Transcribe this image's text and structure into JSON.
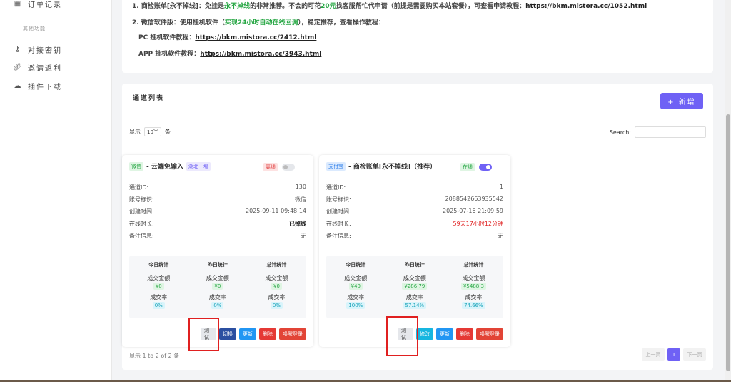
{
  "sidebar": {
    "order_record": "订单记录",
    "section_other": "其他功能",
    "items": [
      {
        "label": "对接密钥",
        "icon": "key-icon"
      },
      {
        "label": "邀请返利",
        "icon": "link-icon"
      },
      {
        "label": "插件下载",
        "icon": "cloud-download-icon"
      }
    ]
  },
  "notice": {
    "line1_prefix": "1. 商检账单[永不掉线]：免挂是",
    "line1_green": "永不掉线",
    "line1_mid": "的非常推荐。不会的可花",
    "line1_green2": "20元",
    "line1_suffix": "找客服帮忙代申请（前提是需要购买本站套餐），可查看申请教程：",
    "line1_link": "https://bkm.mistora.cc/1052.html",
    "line2_prefix": "2. 微信软件版：使用挂机软件（",
    "line2_green": "实现24小时自动在线回调",
    "line2_suffix": "），稳定推荐，查看操作教程：",
    "pc_label": "PC 挂机软件教程：",
    "pc_link": "https://bkm.mistora.cc/2412.html",
    "app_label": "APP 挂机软件教程：",
    "app_link": "https://bkm.mistora.cc/3943.html"
  },
  "list": {
    "title": "通道列表",
    "add_label": "+ 新增",
    "show_label": "显示",
    "page_size": "10",
    "items_label": "条",
    "search_label": "Search:",
    "footer": "显示 1 to 2 of 2 条",
    "prev": "上一页",
    "current_page": "1",
    "next": "下一页"
  },
  "labels": {
    "channel_id": "通道ID:",
    "account": "账号标识:",
    "created": "创建时间:",
    "online": "在线时长:",
    "remark": "备注信息:",
    "today": "今日统计",
    "yesterday": "昨日统计",
    "total": "总计统计",
    "amount": "成交金额",
    "rate": "成交率"
  },
  "channels": [
    {
      "tag": "微信",
      "name": "- 云端免输入",
      "region": "湖北十堰",
      "status": "离线",
      "id": "130",
      "account": "微信",
      "created": "2025-09-11 09:48:14",
      "online": "已掉线",
      "remark": "无",
      "today_amount": "¥0",
      "yesterday_amount": "¥0",
      "total_amount": "¥0",
      "today_rate": "0%",
      "yesterday_rate": "0%",
      "total_rate": "0%",
      "buttons": [
        "测试",
        "切换",
        "更新",
        "删除",
        "唤醒登录"
      ]
    },
    {
      "tag": "支付宝",
      "name": "- 商检账单[永不掉线]（推荐）",
      "status": "在线",
      "id": "1",
      "account": "2088542663935542",
      "created": "2025-07-16 21:09:59",
      "online": "59天17小时12分钟",
      "remark": "无",
      "today_amount": "¥40",
      "yesterday_amount": "¥286.79",
      "total_amount": "¥5488.3",
      "today_rate": "100%",
      "yesterday_rate": "57.14%",
      "total_rate": "74.66%",
      "buttons": [
        "测试",
        "修改",
        "更新",
        "删除",
        "唤醒登录"
      ]
    }
  ]
}
